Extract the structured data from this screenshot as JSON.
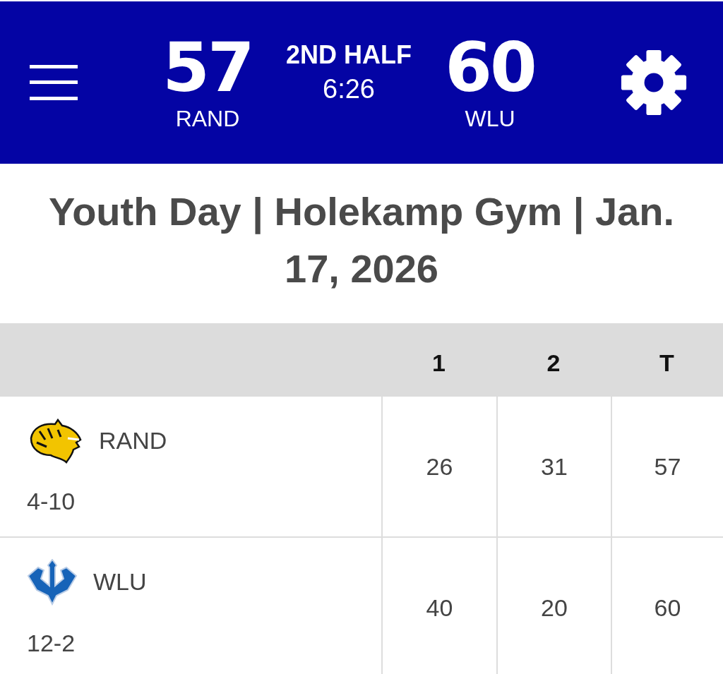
{
  "scoreboard": {
    "home": {
      "score": "57",
      "name": "RAND"
    },
    "period": "2ND HALF",
    "clock": "6:26",
    "away": {
      "score": "60",
      "name": "WLU"
    }
  },
  "title_lines": [
    "Youth Day | Holekamp Gym | Jan.",
    "17, 2026"
  ],
  "table": {
    "columns": [
      "1",
      "2",
      "T"
    ],
    "rows": [
      {
        "kind": "cat",
        "team": "RAND",
        "record": "4-10",
        "scores": [
          "26",
          "31",
          "57"
        ]
      },
      {
        "kind": "trident",
        "team": "WLU",
        "record": "12-2",
        "scores": [
          "40",
          "20",
          "60"
        ]
      }
    ]
  }
}
